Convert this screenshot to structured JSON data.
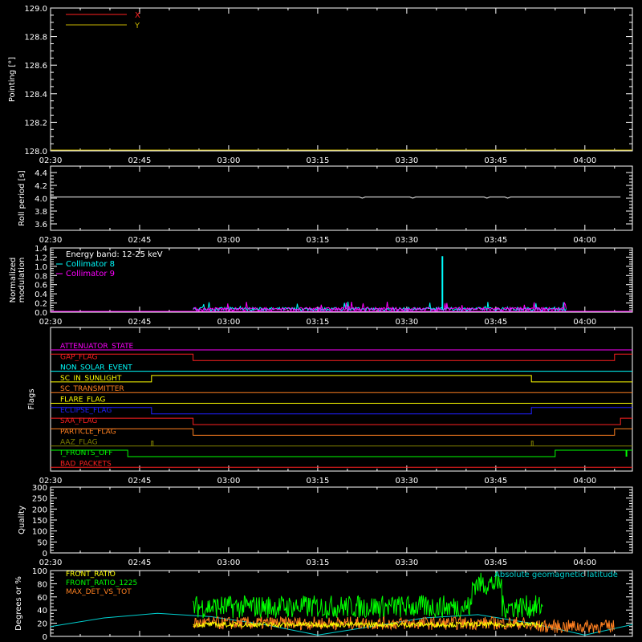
{
  "time_ticks": [
    "02:30",
    "02:45",
    "03:00",
    "03:15",
    "03:30",
    "03:45",
    "04:00"
  ],
  "chart_data": [
    {
      "id": "pointing",
      "type": "line",
      "ylabel": "Pointing [°]",
      "ylim": [
        128.0,
        129.0
      ],
      "yticks": [
        "128.0",
        "128.2",
        "128.4",
        "128.6",
        "128.8",
        "129.0"
      ],
      "series": [
        {
          "name": "X",
          "color": "#ff2020",
          "values": []
        },
        {
          "name": "Y",
          "color": "#c8b400",
          "values": []
        }
      ]
    },
    {
      "id": "roll",
      "type": "line",
      "ylabel": "Roll period [s]",
      "ylim": [
        3.5,
        4.5
      ],
      "yticks": [
        "3.6",
        "3.8",
        "4.0",
        "4.2",
        "4.4"
      ],
      "series": [
        {
          "color": "#ffffff",
          "x": [
            "02:30",
            "04:08"
          ],
          "values": [
            4.02,
            4.02
          ]
        }
      ]
    },
    {
      "id": "modulation",
      "type": "line",
      "ylabel": [
        "Normalized",
        "modulation"
      ],
      "ylim": [
        0.0,
        1.4
      ],
      "yticks": [
        "0.0",
        "0.2",
        "0.4",
        "0.6",
        "0.8",
        "1.0",
        "1.2",
        "1.4"
      ],
      "annotation": "Energy band: 12-25 keV",
      "x_range": [
        "02:54",
        "03:57"
      ],
      "spike": {
        "x": "03:36",
        "value": 1.22
      },
      "series": [
        {
          "name": "Collimator 8",
          "color": "#00ffff",
          "typical": 0.08
        },
        {
          "name": "Collimator 9",
          "color": "#ff00ff",
          "typical": 0.08
        }
      ]
    },
    {
      "id": "flags",
      "type": "line",
      "ylabel": "Flags",
      "flags": [
        {
          "name": "ATTENUATOR_STATE",
          "color": "#ff00ff",
          "segments": [
            [
              "02:30",
              "04:08",
              0
            ]
          ]
        },
        {
          "name": "GAP_FLAG",
          "color": "#ff2020",
          "segments": [
            [
              "02:30",
              "02:54",
              1
            ],
            [
              "02:54",
              "04:05",
              0
            ],
            [
              "04:05",
              "04:08",
              1
            ]
          ]
        },
        {
          "name": "NON_SOLAR_EVENT",
          "color": "#00ffff",
          "segments": [
            [
              "02:30",
              "04:08",
              0
            ]
          ]
        },
        {
          "name": "SC_IN_SUNLIGHT",
          "color": "#ffff00",
          "segments": [
            [
              "02:30",
              "02:47",
              0
            ],
            [
              "02:47",
              "03:51",
              1
            ],
            [
              "03:51",
              "04:08",
              0
            ]
          ]
        },
        {
          "name": "SC_TRANSMITTER",
          "color": "#ff8020",
          "segments": [
            [
              "02:30",
              "04:08",
              0
            ]
          ]
        },
        {
          "name": "FLARE_FLAG",
          "color": "#ffff00",
          "segments": [
            [
              "02:30",
              "04:08",
              0
            ]
          ]
        },
        {
          "name": "ECLIPSE_FLAG",
          "color": "#2020ff",
          "segments": [
            [
              "02:30",
              "02:47",
              1
            ],
            [
              "02:47",
              "03:51",
              0
            ],
            [
              "03:51",
              "04:08",
              1
            ]
          ]
        },
        {
          "name": "SAA_FLAG",
          "color": "#ff2020",
          "segments": [
            [
              "02:30",
              "02:54",
              1
            ],
            [
              "02:54",
              "04:06",
              0
            ],
            [
              "04:06",
              "04:08",
              1
            ]
          ]
        },
        {
          "name": "PARTICLE_FLAG",
          "color": "#ff8020",
          "segments": [
            [
              "02:30",
              "02:54",
              1
            ],
            [
              "02:54",
              "04:05",
              0
            ],
            [
              "04:05",
              "04:08",
              1
            ]
          ]
        },
        {
          "name": "AAZ_FLAG",
          "color": "#808000",
          "segments": [
            [
              "02:30",
              "04:08",
              0
            ]
          ],
          "pulses": [
            "02:47",
            "03:51"
          ]
        },
        {
          "name": "I_FRONTS_OFF",
          "color": "#00ff00",
          "segments": [
            [
              "02:30",
              "02:43",
              1
            ],
            [
              "02:43",
              "03:55",
              0
            ],
            [
              "03:55",
              "04:08",
              1
            ]
          ],
          "pulses_down": [
            "04:07"
          ]
        },
        {
          "name": "BAD_PACKETS",
          "color": "#ff2020",
          "segments": [
            [
              "02:30",
              "04:08",
              0
            ]
          ]
        }
      ]
    },
    {
      "id": "quality",
      "type": "line",
      "ylabel": "Quality",
      "ylim": [
        0,
        300
      ],
      "yticks": [
        "0",
        "50",
        "100",
        "150",
        "200",
        "250",
        "300"
      ],
      "series": []
    },
    {
      "id": "degrees",
      "type": "line",
      "ylabel": "Degrees or %",
      "ylim": [
        0,
        100
      ],
      "yticks": [
        "0",
        "20",
        "40",
        "60",
        "80",
        "100"
      ],
      "annotation": "Absolute geomagnetic latitude",
      "series": [
        {
          "name": "FRONT_RATIO",
          "color": "#ffff00",
          "x_range": [
            "02:54",
            "03:53"
          ],
          "typical": 18
        },
        {
          "name": "FRONT_RATIO_1225",
          "color": "#00ff00",
          "x_range": [
            "02:54",
            "03:53"
          ],
          "typical": 45
        },
        {
          "name": "MAX_DET_VS_TOT",
          "color": "#ff8020",
          "x_range": [
            "02:54",
            "04:05"
          ],
          "typical": 20
        },
        {
          "name": "Absolute geomagnetic latitude",
          "color": "#00d0d0",
          "x": [
            "02:30",
            "02:39",
            "02:48",
            "02:57",
            "03:06",
            "03:15",
            "03:24",
            "03:33",
            "03:42",
            "03:51",
            "04:00",
            "04:08"
          ],
          "values": [
            15,
            28,
            35,
            30,
            18,
            2,
            15,
            28,
            33,
            20,
            2,
            18
          ]
        }
      ]
    }
  ]
}
